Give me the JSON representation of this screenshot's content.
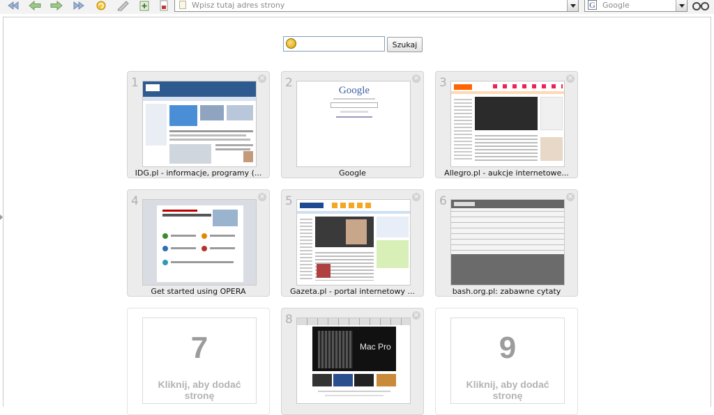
{
  "toolbar": {
    "address_placeholder": "Wpisz tutaj adres strony",
    "search_engine": "Google",
    "search_engine_letter": "G"
  },
  "speed_dial": {
    "search_button": "Szukaj",
    "search_value": "",
    "tiles": [
      {
        "number": "1",
        "caption": "IDG.pl - informacje, programy (..."
      },
      {
        "number": "2",
        "caption": "Google",
        "thumb_text": "Google"
      },
      {
        "number": "3",
        "caption": "Allegro.pl - aukcje internetowe..."
      },
      {
        "number": "4",
        "caption": "Get started using OPERA"
      },
      {
        "number": "5",
        "caption": "Gazeta.pl - portal internetowy ..."
      },
      {
        "number": "6",
        "caption": "bash.org.pl: zabawne cytaty"
      },
      {
        "number": "7",
        "big": "7",
        "caption": "Kliknij, aby dodać stronę"
      },
      {
        "number": "8",
        "caption": "",
        "thumb_text": "Mac Pro"
      },
      {
        "number": "9",
        "big": "9",
        "caption": "Kliknij, aby dodać stronę"
      }
    ]
  },
  "colors": {
    "toolbar_bg": "#f3f3f3",
    "tile_bg": "#ececec",
    "accent_green": "#3d8a2c",
    "accent_blue": "#3a5fa3"
  }
}
